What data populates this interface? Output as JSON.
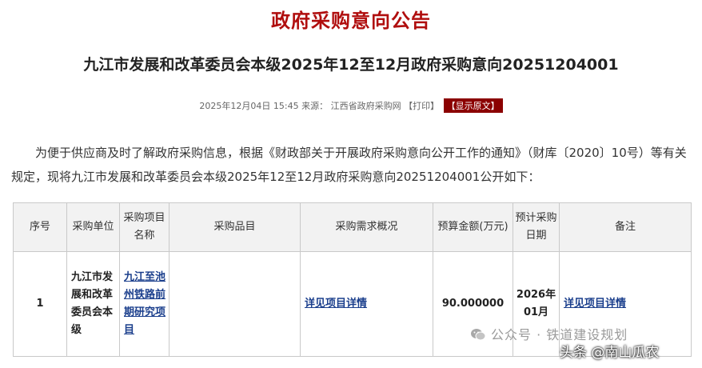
{
  "header": {
    "title": "政府采购意向公告",
    "subtitle": "九江市发展和改革委员会本级2025年12至12月政府采购意向20251204001",
    "datetime": "2025年12月04日 15:45",
    "source_label": "来源：",
    "source_name": "江西省政府采购网",
    "print_label": "【打印】",
    "show_original_label": "【显示原文】"
  },
  "intro": {
    "text": "为便于供应商及时了解政府采购信息，根据《财政部关于开展政府采购意向公开工作的通知》（财库〔2020〕10号）等有关规定，现将九江市发展和改革委员会本级2025年12至12月政府采购意向20251204001公开如下："
  },
  "table": {
    "headers": [
      "序号",
      "采购单位",
      "采购项目名称",
      "采购品目",
      "采购需求概况",
      "预算金额(万元)",
      "预计采购日期",
      "备注"
    ],
    "rows": [
      {
        "no": "1",
        "unit": "九江市发展和改革委员会本级",
        "project_name": "九江至池州铁路前期研究项目",
        "category": "",
        "demand": "详见项目详情",
        "budget": "90.000000",
        "date": "2026年01月",
        "remark": "详见项目详情"
      }
    ]
  },
  "overlays": {
    "wechat_watermark": "公众号 · 铁道建设规划",
    "toutiao_watermark": "头条 @南山瓜农"
  }
}
